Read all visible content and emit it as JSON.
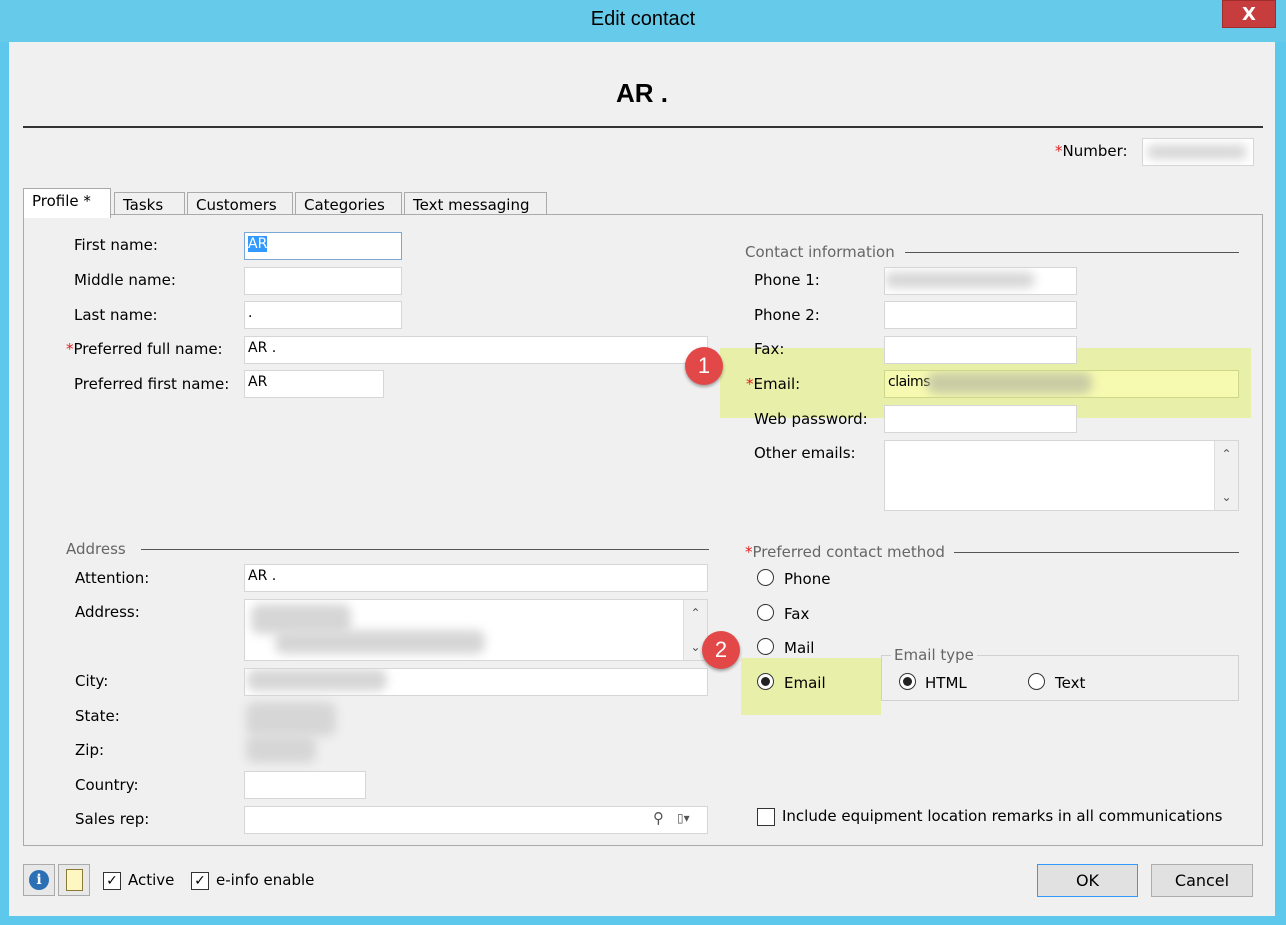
{
  "window": {
    "title": "Edit contact",
    "close_glyph": "X"
  },
  "header": {
    "heading": "AR .",
    "number_label": "Number:"
  },
  "tabs": [
    {
      "label": "Profile *"
    },
    {
      "label": "Tasks"
    },
    {
      "label": "Customers"
    },
    {
      "label": "Categories"
    },
    {
      "label": "Text messaging"
    }
  ],
  "profile": {
    "first_name_label": "First name:",
    "first_name_value": "AR",
    "middle_name_label": "Middle name:",
    "middle_name_value": "",
    "last_name_label": "Last name:",
    "last_name_value": ".",
    "preferred_full_name_label": "Preferred full name:",
    "preferred_full_name_value": "AR .",
    "preferred_first_name_label": "Preferred first name:",
    "preferred_first_name_value": "AR"
  },
  "contact_info": {
    "group_title": "Contact information",
    "phone1_label": "Phone 1:",
    "phone2_label": "Phone 2:",
    "fax_label": "Fax:",
    "email_label": "Email:",
    "email_value": "claims",
    "web_password_label": "Web password:",
    "other_emails_label": "Other emails:"
  },
  "address": {
    "group_title": "Address",
    "attention_label": "Attention:",
    "attention_value": "AR .",
    "address_label": "Address:",
    "city_label": "City:",
    "state_label": "State:",
    "zip_label": "Zip:",
    "country_label": "Country:",
    "country_value": "",
    "sales_rep_label": "Sales rep:"
  },
  "preferred_contact": {
    "group_title": "Preferred contact method",
    "options": [
      "Phone",
      "Fax",
      "Mail",
      "Email"
    ],
    "selected": "Email",
    "email_type_title": "Email type",
    "email_type_options": [
      "HTML",
      "Text"
    ],
    "email_type_selected": "HTML"
  },
  "include_remarks_label": "Include equipment location remarks in all communications",
  "annotations": {
    "badge1": "1",
    "badge2": "2"
  },
  "footer": {
    "active_label": "Active",
    "einfo_label": "e-info enable",
    "ok_label": "OK",
    "cancel_label": "Cancel"
  },
  "icons": [
    "close-icon",
    "info-icon",
    "document-icon",
    "search-icon",
    "dropdown-icon",
    "scroll-up-icon",
    "scroll-down-icon",
    "checkmark-icon"
  ],
  "colors": {
    "title_bar": "#66cbea",
    "close_button": "#c73d3d",
    "required": "#e02020",
    "highlight": "#e2ee78",
    "badge": "#e24848"
  }
}
